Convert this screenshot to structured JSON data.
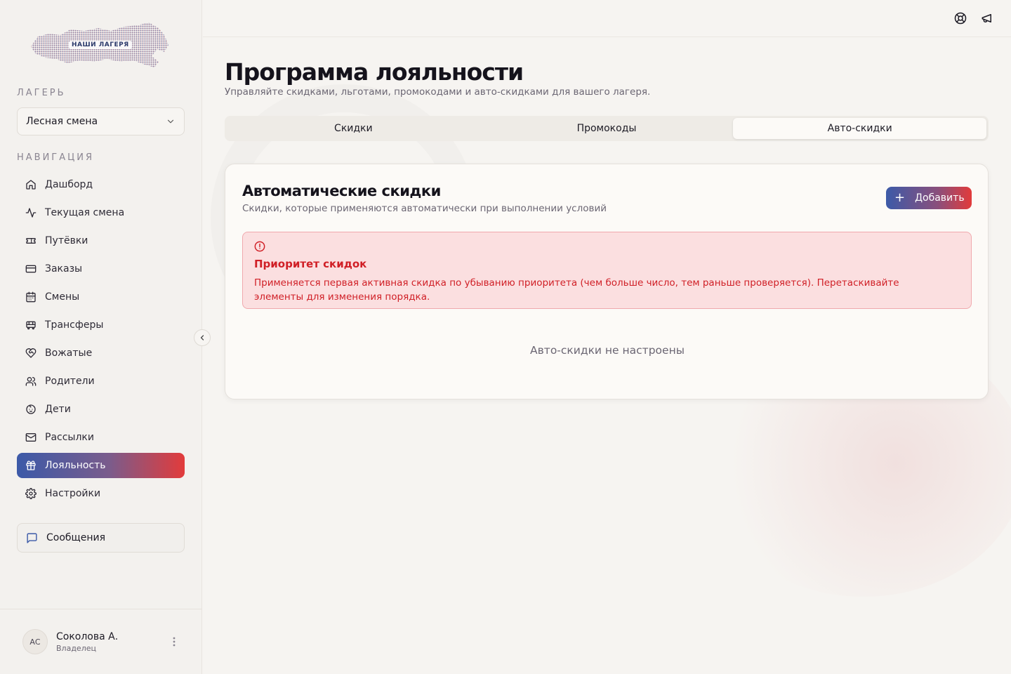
{
  "logo": {
    "text": "НАШИ ЛАГЕРЯ"
  },
  "sidebar": {
    "camp_label": "ЛАГЕРЬ",
    "camp_value": "Лесная смена",
    "nav_label": "НАВИГАЦИЯ",
    "items": [
      {
        "label": "Дашборд",
        "icon": "home-icon"
      },
      {
        "label": "Текущая смена",
        "icon": "activity-icon"
      },
      {
        "label": "Путёвки",
        "icon": "ticket-icon"
      },
      {
        "label": "Заказы",
        "icon": "credit-card-icon"
      },
      {
        "label": "Смены",
        "icon": "calendar-icon"
      },
      {
        "label": "Трансферы",
        "icon": "bus-icon"
      },
      {
        "label": "Вожатые",
        "icon": "heart-handshake-icon"
      },
      {
        "label": "Родители",
        "icon": "users-icon"
      },
      {
        "label": "Дети",
        "icon": "baby-icon"
      },
      {
        "label": "Рассылки",
        "icon": "mail-icon"
      },
      {
        "label": "Лояльность",
        "icon": "gift-icon",
        "active": true
      },
      {
        "label": "Настройки",
        "icon": "gear-icon"
      }
    ],
    "messages_label": "Сообщения",
    "user": {
      "initials": "АС",
      "name": "Соколова А.",
      "role": "Владелец"
    }
  },
  "main": {
    "title": "Программа лояльности",
    "subtitle": "Управляйте скидками, льготами, промокодами и авто-скидками для вашего лагеря.",
    "tabs": [
      {
        "label": "Скидки"
      },
      {
        "label": "Промокоды"
      },
      {
        "label": "Авто-скидки",
        "active": true
      }
    ],
    "card": {
      "title": "Автоматические скидки",
      "subtitle": "Скидки, которые применяются автоматически при выполнении условий",
      "add_label": "Добавить",
      "alert": {
        "title": "Приоритет скидок",
        "text": "Применяется первая активная скидка по убыванию приоритета (чем больше число, тем раньше проверяется). Перетаскивайте элементы для изменения порядка."
      },
      "empty_text": "Авто-скидки не настроены"
    }
  },
  "colors": {
    "accent_start": "#3c5aa8",
    "accent_end": "#e23b3b",
    "alert_bg": "#fbdfe0",
    "alert_text": "#d01f26"
  }
}
